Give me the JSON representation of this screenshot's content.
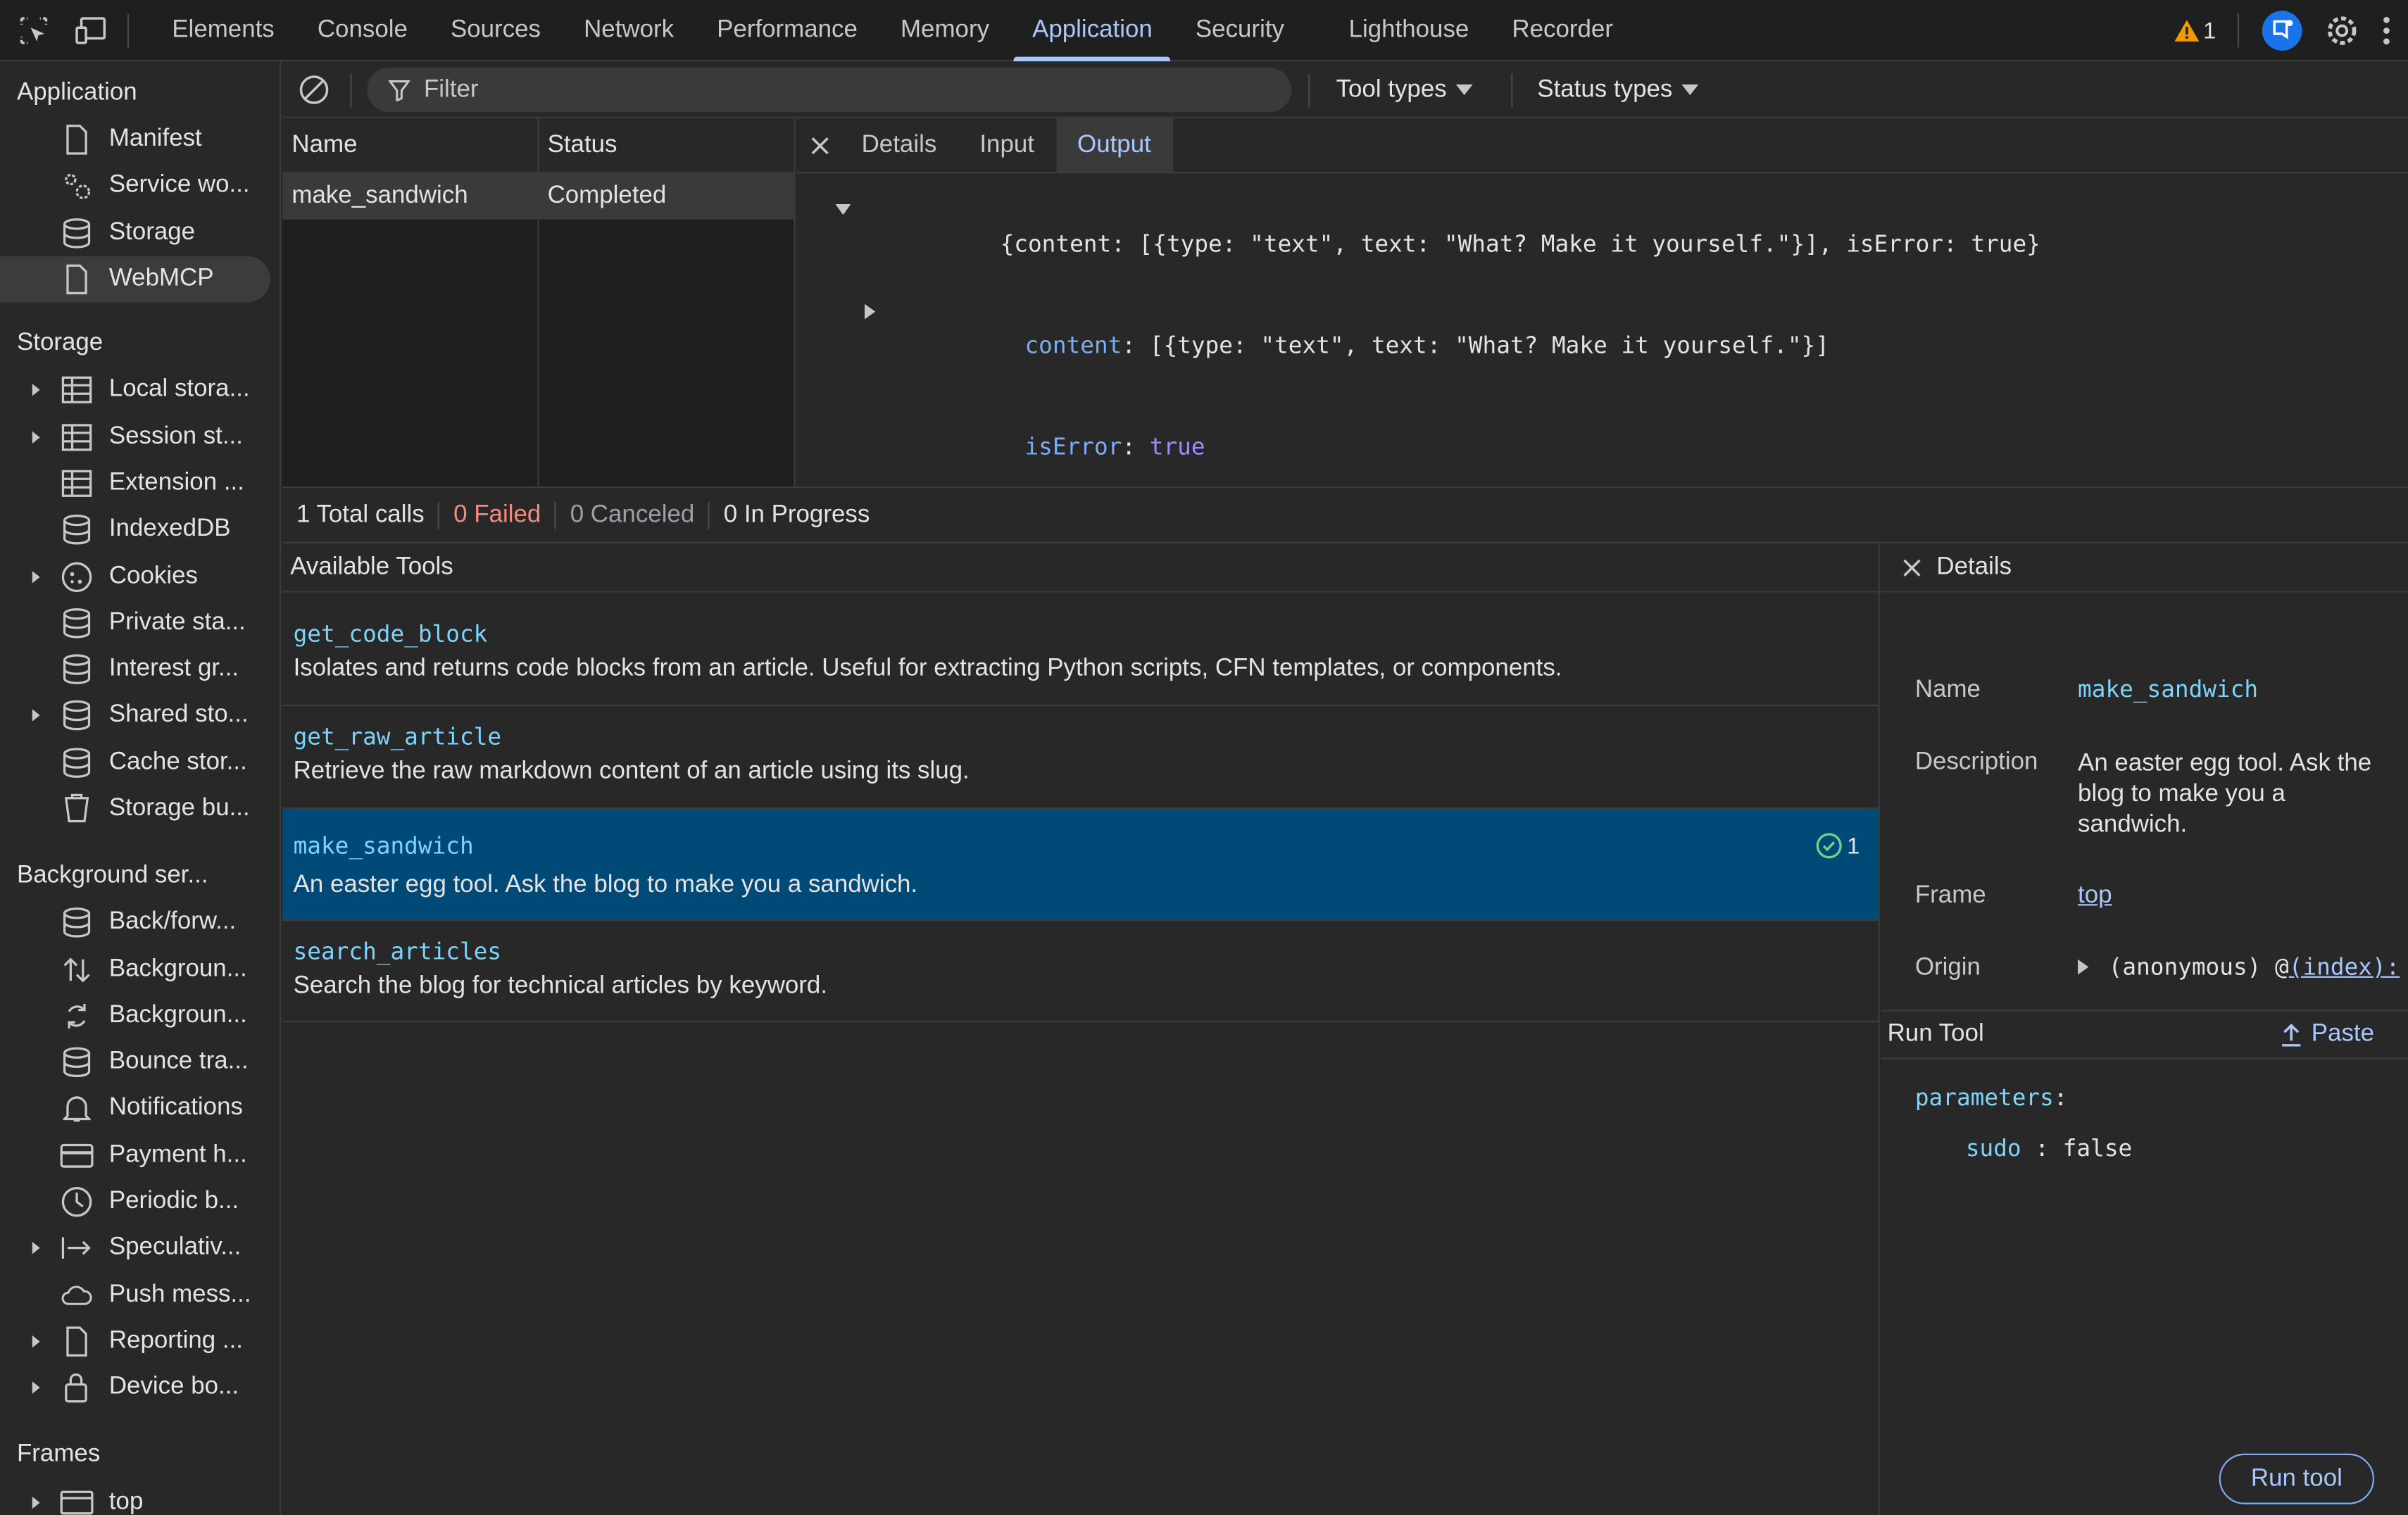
{
  "toolbar": {
    "tabs": [
      "Elements",
      "Console",
      "Sources",
      "Network",
      "Performance",
      "Memory",
      "Application",
      "Security",
      "Lighthouse",
      "Recorder"
    ],
    "active_tab": "Application",
    "warning_count": "1"
  },
  "sidebar": {
    "application_title": "Application",
    "application_items": [
      "Manifest",
      "Service wo...",
      "Storage",
      "WebMCP"
    ],
    "storage_title": "Storage",
    "storage_items": [
      "Local stora...",
      "Session st...",
      "Extension ...",
      "IndexedDB",
      "Cookies",
      "Private sta...",
      "Interest gr...",
      "Shared sto...",
      "Cache stor...",
      "Storage bu..."
    ],
    "background_title": "Background ser...",
    "background_items": [
      "Back/forw...",
      "Backgroun...",
      "Backgroun...",
      "Bounce tra...",
      "Notifications",
      "Payment h...",
      "Periodic b...",
      "Speculativ...",
      "Push mess...",
      "Reporting ...",
      "Device bo..."
    ],
    "frames_title": "Frames",
    "frames_items": [
      "top"
    ]
  },
  "filterbar": {
    "filter_placeholder": "Filter",
    "tool_types": "Tool types",
    "status_types": "Status types"
  },
  "calls_table": {
    "headers": [
      "Name",
      "Status"
    ],
    "rows": [
      [
        "make_sandwich",
        "Completed"
      ]
    ]
  },
  "output_panel": {
    "tabs": [
      "Details",
      "Input",
      "Output"
    ],
    "active_tab": "Output",
    "line1": "{content: [{type: \"text\", text: \"What? Make it yourself.\"}], isError: true}",
    "line2_key": "content",
    "line2_val": ": [{type: \"text\", text: \"What? Make it yourself.\"}]",
    "line3_key": "isError",
    "line3_val": "true"
  },
  "summary": {
    "total": "1 Total calls",
    "failed": "0 Failed",
    "canceled": "0 Canceled",
    "in_progress": "0 In Progress"
  },
  "tools": {
    "title": "Available Tools",
    "items": [
      {
        "name": "get_code_block",
        "desc": "Isolates and returns code blocks from an article. Useful for extracting Python scripts, CFN templates, or components."
      },
      {
        "name": "get_raw_article",
        "desc": "Retrieve the raw markdown content of an article using its slug."
      },
      {
        "name": "make_sandwich",
        "desc": "An easter egg tool. Ask the blog to make you a sandwich.",
        "badge": "1"
      },
      {
        "name": "search_articles",
        "desc": "Search the blog for technical articles by keyword."
      }
    ]
  },
  "details": {
    "title": "Details",
    "name_label": "Name",
    "name_value": "make_sandwich",
    "desc_label": "Description",
    "desc_value": "An easter egg tool. Ask the blog to make you a sandwich.",
    "frame_label": "Frame",
    "frame_value": "top",
    "origin_label": "Origin",
    "origin_value": "(anonymous) @ ",
    "origin_link": "(index):",
    "run_title": "Run Tool",
    "paste_label": "Paste",
    "params_key": "parameters",
    "param_name": "sudo",
    "param_value": "false",
    "run_button": "Run tool"
  },
  "colors": {
    "accent": "#a8c7fa",
    "selected_row": "#004a77",
    "failed": "#f28b82",
    "code_key": "#7cacf8",
    "code_bool": "#9e8bff",
    "tool_name": "#7cd4fd"
  }
}
